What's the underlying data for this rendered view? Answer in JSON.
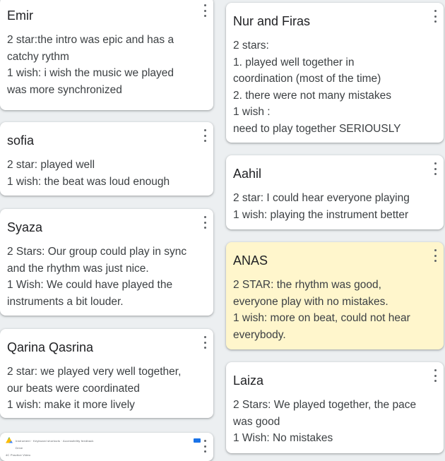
{
  "left_column": [
    {
      "author": "Emir",
      "lines": [
        "2 star:the intro was epic and has a",
        "catchy rythm",
        "1 wish: i wish the music we played",
        "was more synchronized"
      ]
    },
    {
      "author": "sofia",
      "lines": [
        "2 star: played well",
        "1 wish: the beat was loud enough"
      ]
    },
    {
      "author": "Syaza",
      "lines": [
        "2 Stars: Our group could play in sync",
        "and the rhythm was just nice.",
        "1 Wish: We could have played the",
        "instruments a bit louder."
      ]
    },
    {
      "author": "Qarina Qasrina",
      "lines": [
        "2 star: we played very well together,",
        "our beats were coordinated",
        "1 wish: make it more lively"
      ]
    }
  ],
  "right_column": [
    {
      "author": "Nur and Firas",
      "lines": [
        "2 stars:",
        "1. played well together in",
        "coordination (most of the time)",
        "2. there were not many mistakes",
        "1 wish :",
        "need to play together SERIOUSLY"
      ]
    },
    {
      "author": "Aahil",
      "lines": [
        "2 star: I could hear everyone playing",
        "1 wish: playing the instrument better"
      ]
    },
    {
      "author": "ANAS",
      "lines": [
        "2 STAR: the rhythm was good,",
        "everyone play with no mistakes.",
        "1 wish: more on beat, could not hear",
        "everybody."
      ],
      "highlight_color": "#fff6cc"
    },
    {
      "author": "Laiza",
      "lines": [
        "2 Stars: We played together, the pace",
        "was good",
        "1 Wish: No mistakes"
      ]
    }
  ],
  "thumbnail_card": {
    "app_label": "Drive",
    "header_text": "Instrument · Keyboard shortcuts · Accessibility feedback",
    "subtext": "4C Practice Video"
  },
  "menu_icon": "more-vert-icon"
}
